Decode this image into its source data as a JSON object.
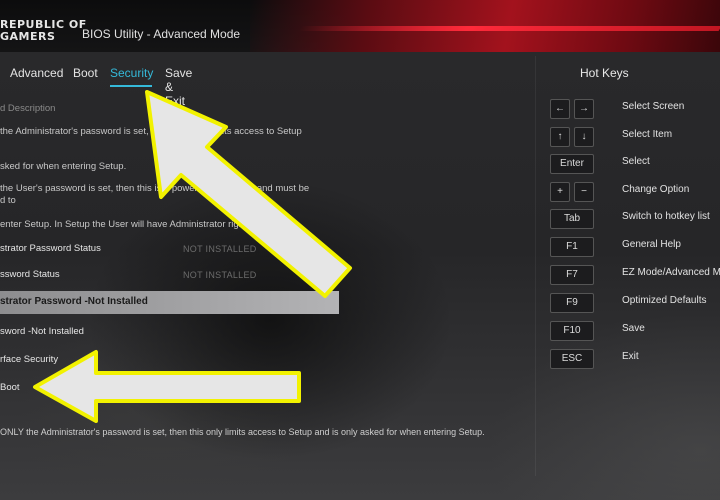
{
  "header": {
    "logo_line1": "REPUBLIC OF",
    "logo_line2": "GAMERS",
    "title": "BIOS Utility - Advanced Mode"
  },
  "tabs": [
    {
      "label": "Advanced",
      "active": false
    },
    {
      "label": "Boot",
      "active": false
    },
    {
      "label": "Security",
      "active": true
    },
    {
      "label": "Save & Exit",
      "active": false
    }
  ],
  "security": {
    "section_heading": "d Description",
    "admin_desc": "the Administrator's password is set, then this only limits access to Setup",
    "admin_desc_cont": "sked for when entering Setup.",
    "user_desc": "the User's password is set, then this is a power on password and must be",
    "user_desc_cont": "d to",
    "user_desc_cont2": "enter Setup. In Setup the User will have Administrator rights.",
    "admin_status_label": "strator Password Status",
    "admin_status_value": "NOT INSTALLED",
    "user_status_label": "ssword Status",
    "user_status_value": "NOT INSTALLED",
    "selected_item": "strator Password -Not Installed",
    "user_password_item": "sword -Not Installed",
    "interface_security": "rface Security",
    "secure_boot": "Boot"
  },
  "footer_note": "ONLY the Administrator's password is set, then this only limits access to Setup and is only asked for when entering Setup.",
  "hotkeys": {
    "title": "Hot Keys",
    "items": [
      {
        "keys": [
          "←",
          "→"
        ],
        "desc": "Select Screen"
      },
      {
        "keys": [
          "↑",
          "↓"
        ],
        "desc": "Select Item"
      },
      {
        "keys": [
          "Enter"
        ],
        "desc": "Select"
      },
      {
        "keys": [
          "+",
          "−"
        ],
        "desc": "Change Option"
      },
      {
        "keys": [
          "Tab"
        ],
        "desc": "Switch to hotkey list"
      },
      {
        "keys": [
          "F1"
        ],
        "desc": "General Help"
      },
      {
        "keys": [
          "F7"
        ],
        "desc": "EZ Mode/Advanced Mod"
      },
      {
        "keys": [
          "F9"
        ],
        "desc": "Optimized Defaults"
      },
      {
        "keys": [
          "F10"
        ],
        "desc": "Save"
      },
      {
        "keys": [
          "ESC"
        ],
        "desc": "Exit"
      }
    ]
  },
  "colors": {
    "active_tab": "#35b9d9",
    "arrow_fill": "#e6e6e6",
    "arrow_outline": "#f2f200",
    "header_red": "#a3121d"
  },
  "icons": {
    "arrow_top": "annotation-arrow-icon",
    "arrow_bottom": "annotation-arrow-icon"
  }
}
